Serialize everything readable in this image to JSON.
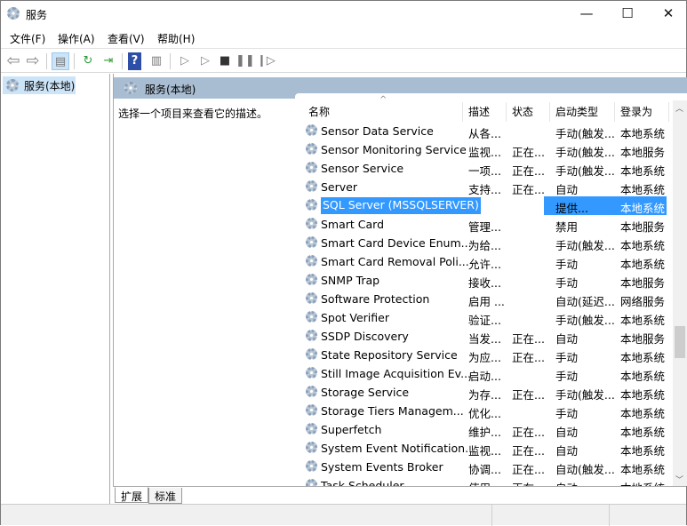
{
  "window": {
    "title": "服务",
    "min": "—",
    "max": "☐",
    "close": "✕"
  },
  "menu": [
    "文件(F)",
    "操作(A)",
    "查看(V)",
    "帮助(H)"
  ],
  "toolbar": {
    "icons": [
      "back-icon",
      "forward-icon",
      "show-hide-console-tree-icon",
      "refresh-icon",
      "export-list-icon",
      "help-icon",
      "properties-icon",
      "start-icon",
      "start-alt-icon",
      "stop-icon",
      "pause-icon",
      "resume-icon"
    ]
  },
  "tree": {
    "root": "服务(本地)"
  },
  "pane": {
    "header": "服务(本地)",
    "description": "选择一个项目来查看它的描述。"
  },
  "columns": [
    "名称",
    "描述",
    "状态",
    "启动类型",
    "登录为"
  ],
  "rows": [
    [
      "Sensor Data Service",
      "从各...",
      "",
      "手动(触发...",
      "本地系统"
    ],
    [
      "Sensor Monitoring Service",
      "监视...",
      "正在...",
      "手动(触发...",
      "本地服务"
    ],
    [
      "Sensor Service",
      "一项...",
      "正在...",
      "手动(触发...",
      "本地系统"
    ],
    [
      "Server",
      "支持...",
      "正在...",
      "自动",
      "本地系统"
    ],
    [
      "SQL Server (MSSQLSERVER)",
      "",
      "",
      "提供...",
      "本地系统"
    ],
    [
      "Smart Card",
      "管理...",
      "",
      "禁用",
      "本地服务"
    ],
    [
      "Smart Card Device Enum...",
      "为给...",
      "",
      "手动(触发...",
      "本地系统"
    ],
    [
      "Smart Card Removal Poli...",
      "允许...",
      "",
      "手动",
      "本地系统"
    ],
    [
      "SNMP Trap",
      "接收...",
      "",
      "手动",
      "本地服务"
    ],
    [
      "Software Protection",
      "启用 ...",
      "",
      "自动(延迟...",
      "网络服务"
    ],
    [
      "Spot Verifier",
      "验证...",
      "",
      "手动(触发...",
      "本地系统"
    ],
    [
      "SSDP Discovery",
      "当发...",
      "正在...",
      "自动",
      "本地服务"
    ],
    [
      "State Repository Service",
      "为应...",
      "正在...",
      "手动",
      "本地系统"
    ],
    [
      "Still Image Acquisition Ev...",
      "启动...",
      "",
      "手动",
      "本地系统"
    ],
    [
      "Storage Service",
      "为存...",
      "正在...",
      "手动(触发...",
      "本地系统"
    ],
    [
      "Storage Tiers Managem...",
      "优化...",
      "",
      "手动",
      "本地系统"
    ],
    [
      "Superfetch",
      "维护...",
      "正在...",
      "自动",
      "本地系统"
    ],
    [
      "System Event Notification...",
      "监视...",
      "正在...",
      "自动",
      "本地系统"
    ],
    [
      "System Events Broker",
      "协调...",
      "正在...",
      "自动(触发...",
      "本地系统"
    ],
    [
      "Task Scheduler",
      "使用...",
      "正在...",
      "自动",
      "本地系统"
    ]
  ],
  "selected_row": 4,
  "tabs": [
    "扩展",
    "标准"
  ],
  "colors": {
    "selection": "#3399ff",
    "header_band": "#a9bdd2",
    "tree_selection": "#cce4f7"
  }
}
